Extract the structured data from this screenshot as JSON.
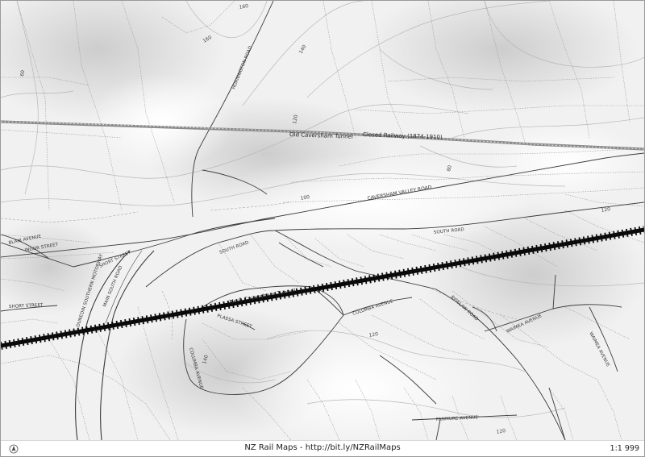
{
  "map": {
    "contour_labels": [
      "160",
      "160",
      "140",
      "120",
      "100",
      "80",
      "60",
      "120",
      "140",
      "120",
      "120"
    ],
    "roads": {
      "hornington": "HORNINGTON ROAD",
      "caversham_valley": "CAVERSHAM VALLEY ROAD",
      "south_road_east": "SOUTH ROAD",
      "south_road_west": "SOUTH ROAD",
      "blair": "BLAIR AVENUE",
      "ingor": "INGOR STREET",
      "short_street_1": "SHORT STREET",
      "short_street_2": "SHORT STREET",
      "motorway": "DUNEDIN SOUTHERN MOTORWAY",
      "main_south": "MAIN SOUTH ROAD",
      "plassa": "PLASSA STREET",
      "columba_avenue_1": "COLUMBA AVENUE",
      "columba_avenue_2": "COLUMBA AVENUE",
      "riselaw": "RISELAW ROAD",
      "waimea_1": "WAIMEA AVENUE",
      "waimea_2": "WAIMEA AVENUE",
      "panmure": "PANMURE AVENUE"
    },
    "railways": {
      "old_tunnel": "Old Caversham Tunnel",
      "closed_railway": "Closed Railway (1874-1910)",
      "no9_tunnel": "No.9 Caversham Tunnel"
    }
  },
  "footer": {
    "attribution": "NZ Rail Maps - http://bit.ly/NZRailMaps",
    "scale": "1:1 999",
    "north_icon": "north-arrow-icon"
  }
}
